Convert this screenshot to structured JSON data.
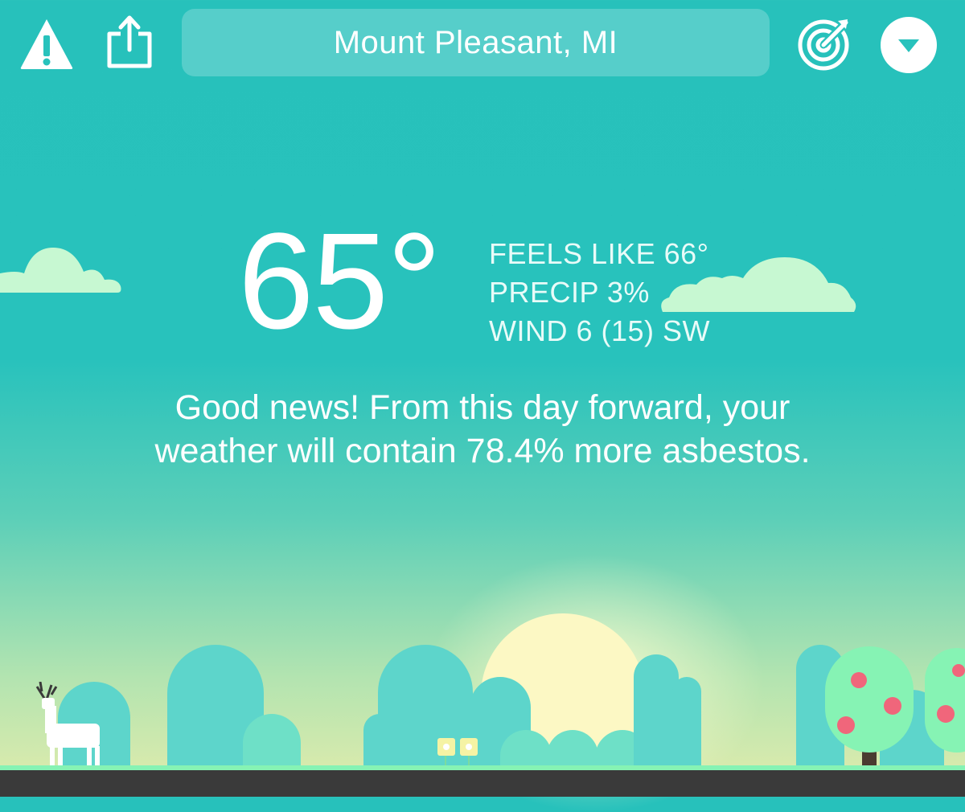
{
  "header": {
    "location": "Mount Pleasant, MI"
  },
  "weather": {
    "temperature": "65°",
    "feels_like": "FEELS LIKE 66°",
    "precip": "PRECIP 3%",
    "wind": "WIND 6 (15) SW",
    "message": "Good news! From this day forward, your weather will contain 78.4% more asbestos."
  },
  "icons": {
    "alert": "warning-triangle",
    "share": "share-box-arrow",
    "radar": "radar-target",
    "menu": "chevron-down-circle"
  },
  "colors": {
    "sky_top": "#27c1bb",
    "sky_bottom": "#e3ecac",
    "hill": "#5dd5cb",
    "tree": "#86f3b4",
    "fruit": "#f0667b",
    "cloud": "#c7f8d2"
  }
}
